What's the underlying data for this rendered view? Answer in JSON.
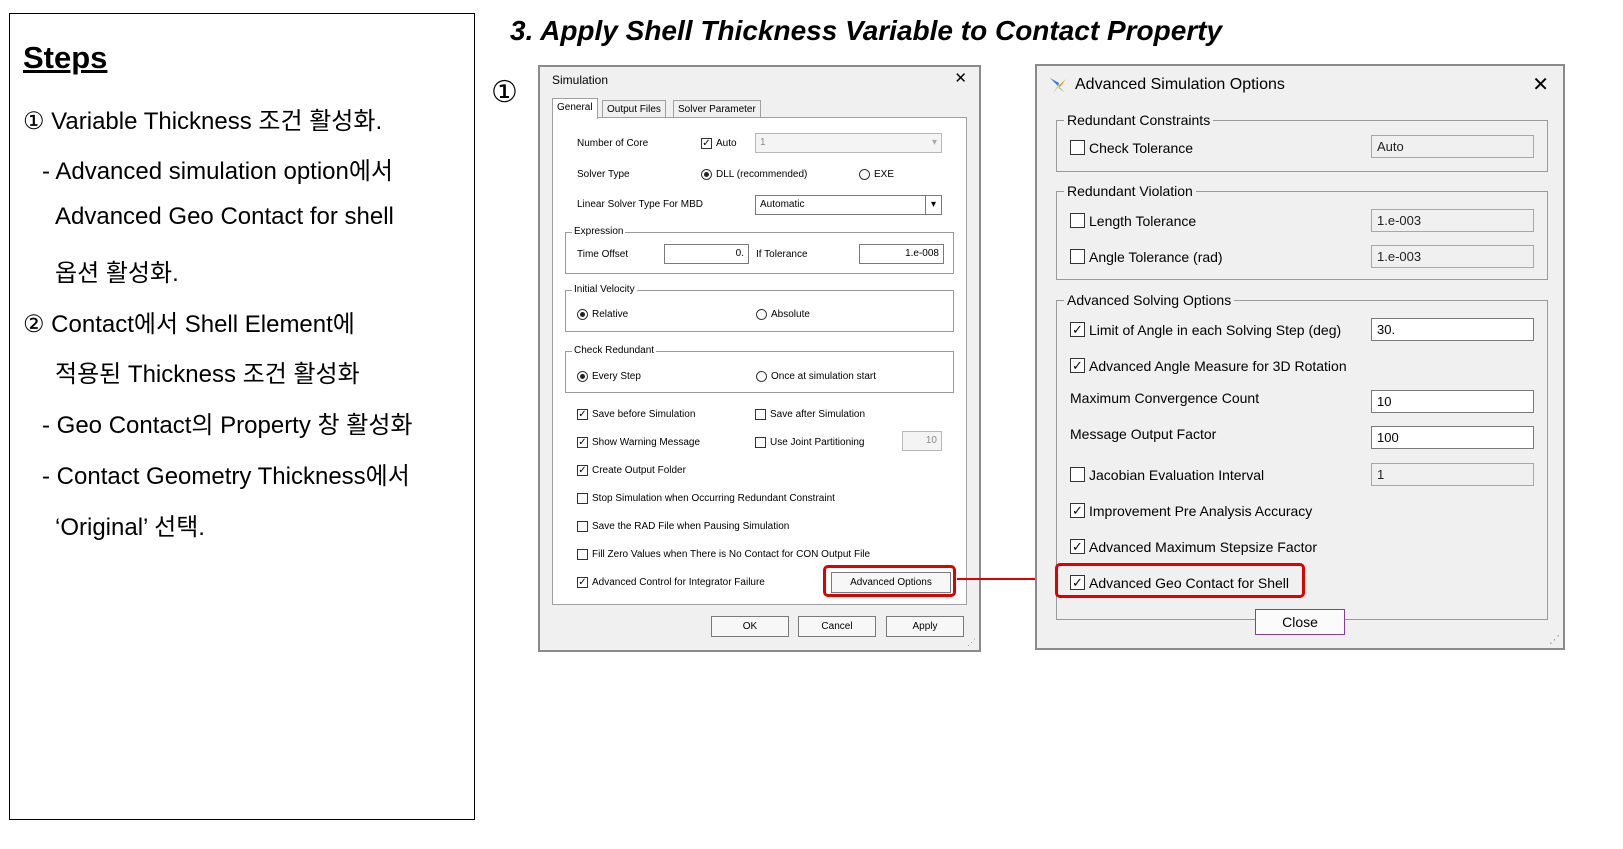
{
  "steps": {
    "title": "Steps",
    "lines": [
      "① Variable Thickness 조건 활성화.",
      "- Advanced simulation option에서",
      "Advanced Geo Contact for shell",
      "옵션 활성화.",
      "② Contact에서 Shell Element에",
      "적용된 Thickness 조건 활성화",
      "- Geo Contact의 Property 창 활성화",
      "- Contact Geometry Thickness에서",
      "‘Original’ 선택."
    ]
  },
  "heading": "3. Apply Shell Thickness Variable to Contact Property",
  "marker": "①",
  "simulation": {
    "title": "Simulation",
    "close_glyph": "✕",
    "tabs": [
      "General",
      "Output Files",
      "Solver Parameter"
    ],
    "number_of_core_label": "Number of Core",
    "auto_label": "Auto",
    "auto_checked": true,
    "core_value": "1",
    "solver_type_label": "Solver Type",
    "solver_dll": "DLL (recommended)",
    "solver_exe": "EXE",
    "linear_solver_label": "Linear Solver Type For MBD",
    "linear_solver_value": "Automatic",
    "expression_group": "Expression",
    "time_offset_label": "Time Offset",
    "time_offset_value": "0.",
    "if_tolerance_label": "If Tolerance",
    "if_tolerance_value": "1.e-008",
    "initial_velocity_group": "Initial Velocity",
    "relative": "Relative",
    "absolute": "Absolute",
    "check_redundant_group": "Check Redundant",
    "every_step": "Every Step",
    "once_at_start": "Once at simulation start",
    "save_before": "Save before Simulation",
    "save_after": "Save after Simulation",
    "show_warning": "Show Warning Message",
    "use_joint_partitioning": "Use Joint Partitioning",
    "joint_partitioning_value": "10",
    "create_output_folder": "Create Output Folder",
    "stop_simulation": "Stop Simulation when Occurring Redundant Constraint",
    "save_rad": "Save the RAD File when Pausing Simulation",
    "fill_zero": "Fill Zero Values when There is No Contact for CON Output File",
    "advanced_control": "Advanced Control for Integrator Failure",
    "advanced_options_button": "Advanced Options",
    "ok": "OK",
    "cancel": "Cancel",
    "apply": "Apply"
  },
  "advanced": {
    "title": "Advanced Simulation Options",
    "close_glyph": "✕",
    "redundant_constraints": "Redundant Constraints",
    "check_tolerance": "Check Tolerance",
    "check_tolerance_value": "Auto",
    "redundant_violation": "Redundant Violation",
    "length_tolerance": "Length Tolerance",
    "length_tolerance_value": "1.e-003",
    "angle_tolerance": "Angle Tolerance (rad)",
    "angle_tolerance_value": "1.e-003",
    "advanced_solving_options": "Advanced Solving Options",
    "limit_of_angle": "Limit of Angle in each Solving Step (deg)",
    "limit_of_angle_value": "30.",
    "advanced_angle_measure": "Advanced Angle Measure for 3D Rotation",
    "max_convergence": "Maximum Convergence Count",
    "max_convergence_value": "10",
    "message_output_factor": "Message Output Factor",
    "message_output_factor_value": "100",
    "jacobian_interval": "Jacobian Evaluation Interval",
    "jacobian_interval_value": "1",
    "improvement_pre_analysis": "Improvement Pre Analysis Accuracy",
    "advanced_max_stepsize": "Advanced Maximum Stepsize Factor",
    "advanced_geo_contact": "Advanced Geo Contact for Shell",
    "close_button": "Close"
  },
  "check_glyph": "✓",
  "highlight_color": "#e00000",
  "accent_color": "#8b3a9e"
}
